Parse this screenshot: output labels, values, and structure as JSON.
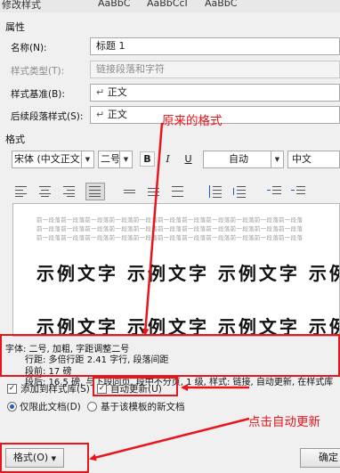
{
  "window": {
    "title": "修改样式",
    "ghost_tabs": [
      "AaBbC",
      "AaBbCcI",
      "AaBbC"
    ]
  },
  "properties": {
    "group_label": "属性",
    "name": {
      "label": "名称(N):",
      "value": "标题 1"
    },
    "style_type": {
      "label": "样式类型(T):",
      "value": "链接段落和字符"
    },
    "based_on": {
      "label": "样式基准(B):",
      "value": "正文",
      "glyph": "↵"
    },
    "following": {
      "label": "后续段落样式(S):",
      "value": "正文",
      "glyph": "↵"
    }
  },
  "format": {
    "group_label": "格式",
    "font": "宋体 (中文正文)",
    "size": "二号",
    "bold": "B",
    "italic": "I",
    "underline": "U",
    "color": "自动",
    "script": "中文"
  },
  "preview": {
    "prev_para_line": "前一段落前一段落前一段落前一段落前一段落前一段落前一段落前一段落前一段落前一段落前一段落",
    "sample_line": "示例文字 示例文字 示例文字 示例文字"
  },
  "description": {
    "lines": [
      "字体: 二号, 加粗, 字距调整二号",
      "行距: 多倍行距 2.41 字行, 段落间距",
      "段前: 17 磅",
      "段后: 16.5 磅, 与下段同页, 段中不分页, 1 级, 样式: 链接, 自动更新, 在样式库"
    ]
  },
  "options": {
    "add_to_gallery": {
      "label": "添加到样式库(S)",
      "checked": true
    },
    "auto_update": {
      "label": "自动更新(U)",
      "checked": true
    },
    "only_this_doc": {
      "label": "仅限此文档(D)",
      "selected": true
    },
    "new_docs": {
      "label": "基于该模板的新文档",
      "selected": false
    }
  },
  "buttons": {
    "format": "格式(O)",
    "ok": "确定"
  },
  "annotations": {
    "original_format": "原来的格式",
    "click_auto_update": "点击自动更新",
    "color": "#e8151b"
  }
}
